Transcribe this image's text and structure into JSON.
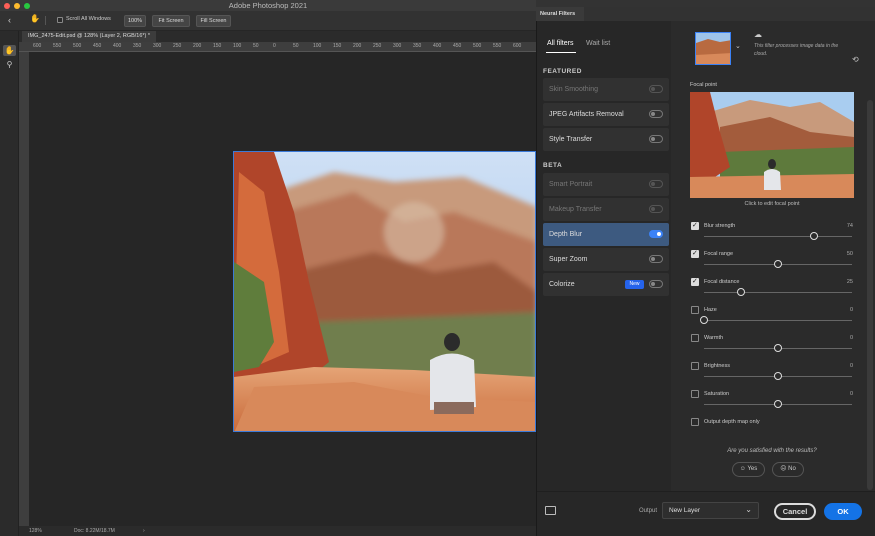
{
  "app": {
    "title": "Adobe Photoshop 2021"
  },
  "options_bar": {
    "scroll_all_windows": "Scroll All Windows",
    "zoom_btn": "100%",
    "fit_screen_btn": "Fit Screen",
    "fill_screen_btn": "Fill Screen"
  },
  "document": {
    "tab_label": "IMG_2475-Edit.psd @ 128% (Layer 2, RGB/16*) *",
    "ruler_ticks": [
      "600",
      "550",
      "500",
      "450",
      "400",
      "350",
      "300",
      "250",
      "200",
      "150",
      "100",
      "50",
      "0",
      "50",
      "100",
      "150",
      "200",
      "250",
      "300",
      "350",
      "400",
      "450",
      "500",
      "550",
      "600"
    ],
    "status_zoom": "128%",
    "status_doc": "Doc: 8.22M/18.7M"
  },
  "neural_filters": {
    "panel_title": "Neural Filters",
    "tabs": {
      "all": "All filters",
      "wait": "Wait list"
    },
    "featured_heading": "FEATURED",
    "beta_heading": "BETA",
    "featured": [
      {
        "label": "Skin Smoothing",
        "enabled": false,
        "on": false
      },
      {
        "label": "JPEG Artifacts Removal",
        "enabled": true,
        "on": false
      },
      {
        "label": "Style Transfer",
        "enabled": true,
        "on": false
      }
    ],
    "beta": [
      {
        "label": "Smart Portrait",
        "enabled": false,
        "on": false
      },
      {
        "label": "Makeup Transfer",
        "enabled": false,
        "on": false
      },
      {
        "label": "Depth Blur",
        "enabled": true,
        "on": true,
        "selected": true
      },
      {
        "label": "Super Zoom",
        "enabled": true,
        "on": false
      },
      {
        "label": "Colorize",
        "enabled": true,
        "on": false,
        "badge": "New"
      }
    ],
    "cloud_note": "This filter processes image data in the cloud.",
    "focal_point_heading": "Focal point",
    "focal_caption": "Click to edit focal point",
    "sliders": [
      {
        "label": "Blur strength",
        "value": "74",
        "checked": true,
        "fraction": 0.74
      },
      {
        "label": "Focal range",
        "value": "50",
        "checked": true,
        "fraction": 0.5
      },
      {
        "label": "Focal distance",
        "value": "25",
        "checked": true,
        "fraction": 0.25
      },
      {
        "label": "Haze",
        "value": "0",
        "checked": false,
        "fraction": 0.0
      },
      {
        "label": "Warmth",
        "value": "0",
        "checked": false,
        "fraction": 0.5
      },
      {
        "label": "Brightness",
        "value": "0",
        "checked": false,
        "fraction": 0.5
      },
      {
        "label": "Saturation",
        "value": "0",
        "checked": false,
        "fraction": 0.5
      }
    ],
    "depth_map_only": "Output depth map only",
    "satisfied_question": "Are you satisfied with the results?",
    "yes_label": "Yes",
    "no_label": "No",
    "output_label": "Output",
    "output_value": "New Layer",
    "cancel_label": "Cancel",
    "ok_label": "OK"
  },
  "colors": {
    "accent": "#1473e6",
    "selected_row": "#3d5a80"
  }
}
